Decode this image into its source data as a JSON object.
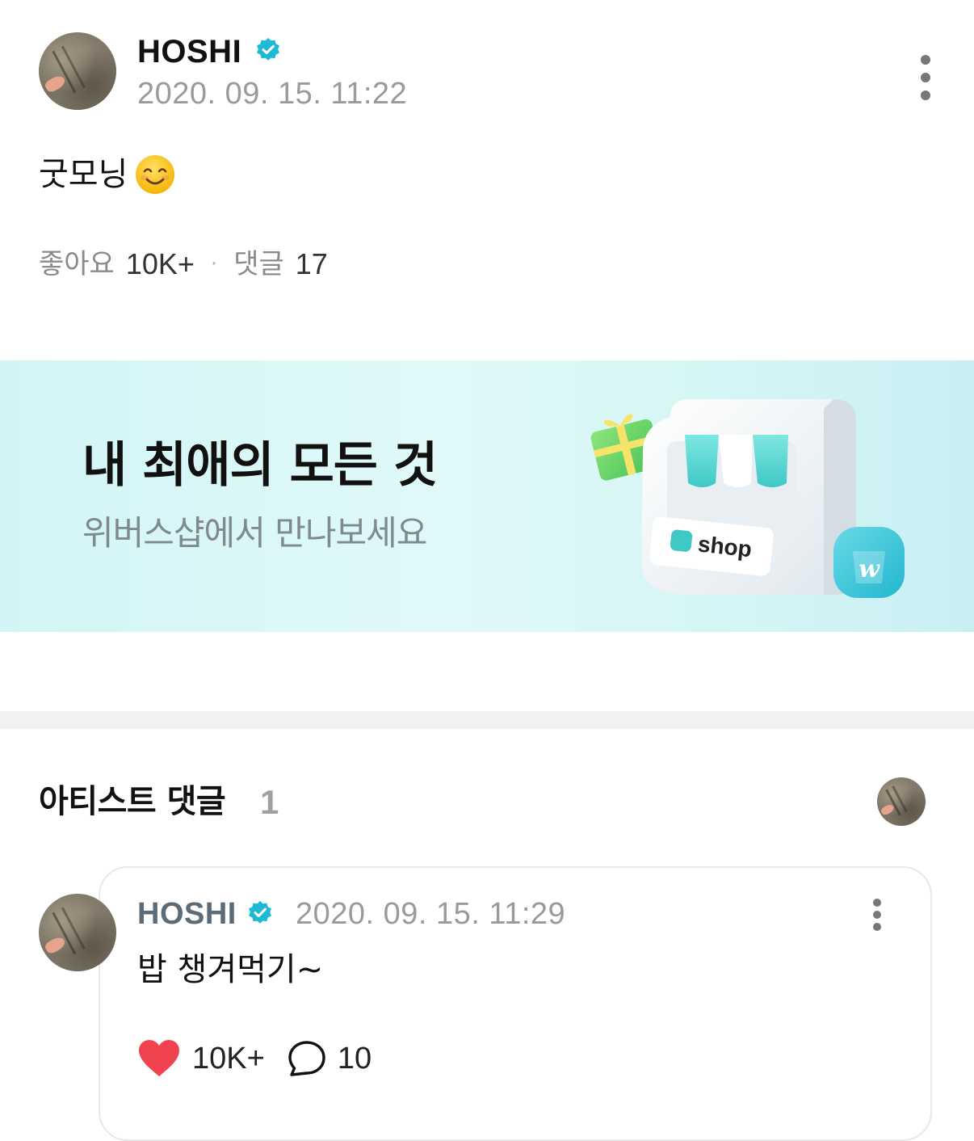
{
  "post": {
    "author": "HOSHI",
    "verified_icon": "verified-badge-icon",
    "date": "2020. 09. 15. 11:22",
    "text": "굿모닝",
    "emoji_icon": "smiling-face-icon",
    "stats": {
      "likes_label": "좋아요",
      "likes_value": "10K+",
      "separator": "·",
      "comments_label": "댓글",
      "comments_value": "17"
    }
  },
  "banner": {
    "title": "내 최애의 모든 것",
    "subtitle": "위버스샵에서 만나보세요",
    "shop_sign": "shop",
    "bag_letter": "w"
  },
  "artist_comments": {
    "title": "아티스트 댓글",
    "count": "1",
    "items": [
      {
        "author": "HOSHI",
        "date": "2020. 09. 15. 11:29",
        "text": "밥 챙겨먹기~",
        "likes": "10K+",
        "replies": "10"
      }
    ]
  },
  "colors": {
    "accent_verified": "#1fb9d6",
    "like_heart": "#f0434f",
    "banner_bg": "#d7f6f6"
  }
}
